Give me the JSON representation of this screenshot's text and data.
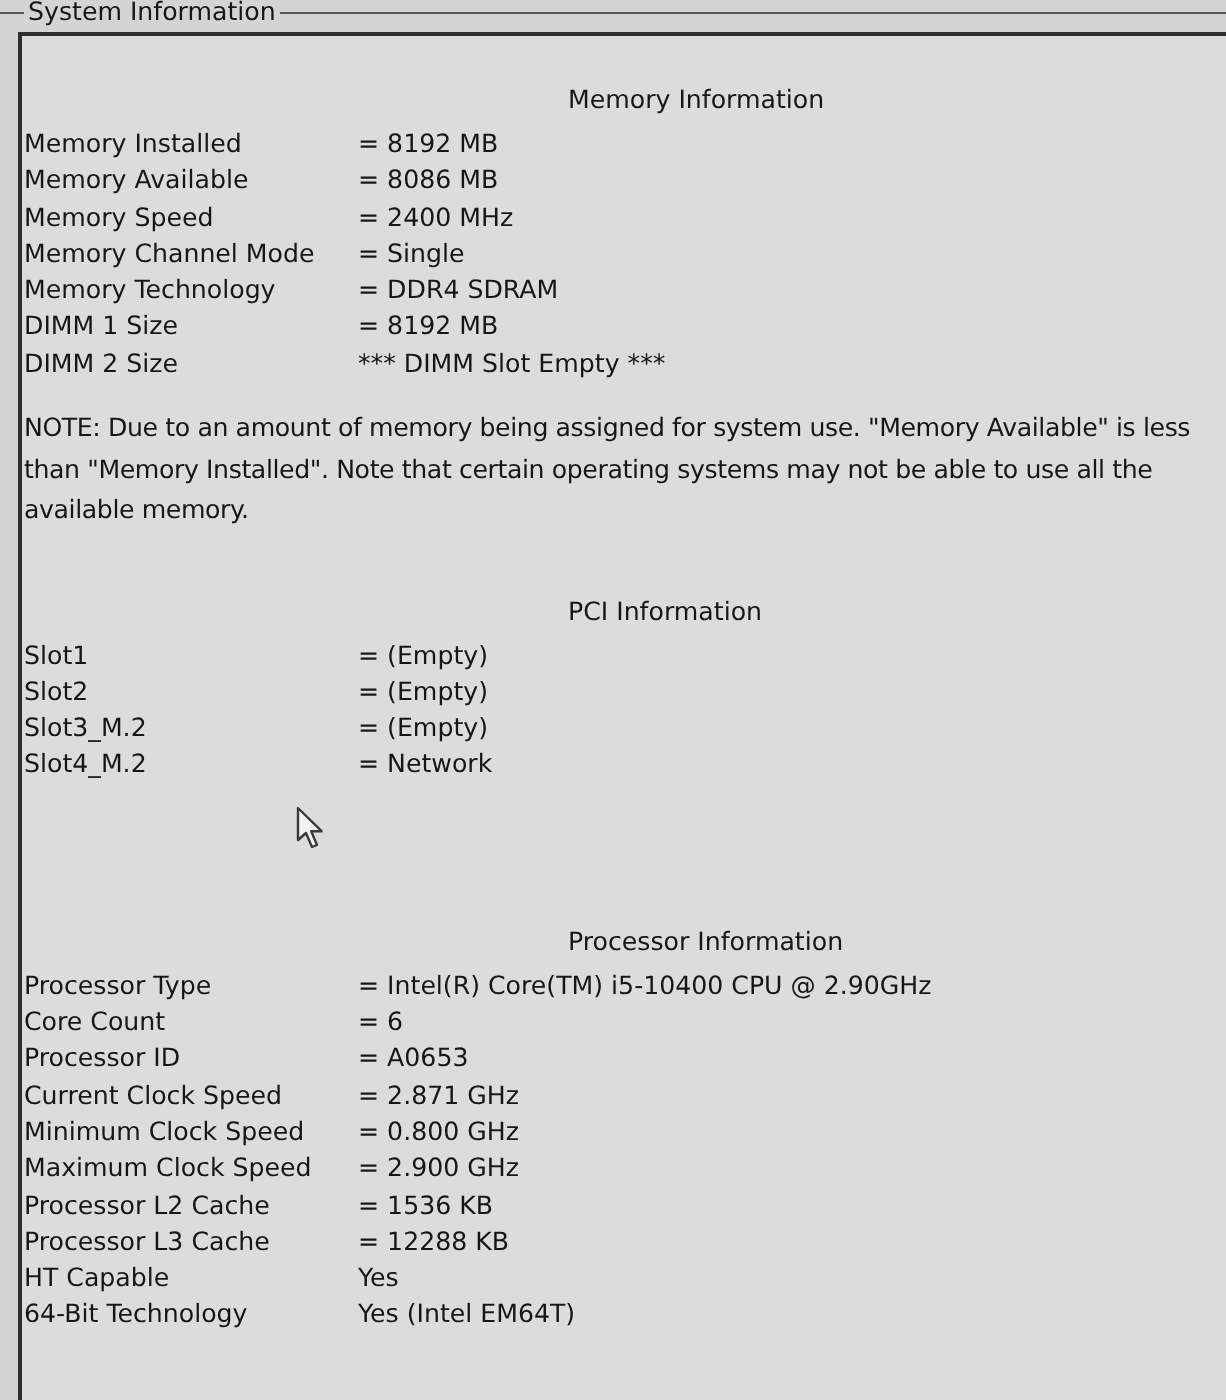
{
  "group_box": {
    "title": "System Information"
  },
  "sections": [
    {
      "heading": "Memory Information",
      "rows": [
        {
          "label": "Memory Installed",
          "value": "= 8192 MB"
        },
        {
          "label": "Memory Available",
          "value": "= 8086 MB"
        },
        {
          "label": "Memory Speed",
          "value": "= 2400 MHz"
        },
        {
          "label": "Memory Channel Mode",
          "value": "= Single"
        },
        {
          "label": "Memory Technology",
          "value": "= DDR4 SDRAM"
        },
        {
          "label": "DIMM 1 Size",
          "value": "= 8192 MB"
        },
        {
          "label": "DIMM 2 Size",
          "value": "*** DIMM Slot Empty ***"
        }
      ],
      "note": "NOTE: Due to an amount of memory being assigned for system use. \"Memory Available\" is less than \"Memory Installed\". Note that certain operating systems may not be able to use all the available memory."
    },
    {
      "heading": "PCI Information",
      "rows": [
        {
          "label": "Slot1",
          "value": "= (Empty)"
        },
        {
          "label": "Slot2",
          "value": "= (Empty)"
        },
        {
          "label": "Slot3_M.2",
          "value": "= (Empty)"
        },
        {
          "label": "Slot4_M.2",
          "value": "= Network"
        }
      ]
    },
    {
      "heading": "Processor Information",
      "rows": [
        {
          "label": "Processor Type",
          "value": "= Intel(R) Core(TM) i5-10400 CPU @ 2.90GHz"
        },
        {
          "label": "Core Count",
          "value": "= 6"
        },
        {
          "label": "Processor ID",
          "value": "= A0653"
        },
        {
          "label": "Current Clock Speed",
          "value": "= 2.871 GHz"
        },
        {
          "label": "Minimum Clock Speed",
          "value": "= 0.800 GHz"
        },
        {
          "label": "Maximum Clock Speed",
          "value": "= 2.900 GHz"
        },
        {
          "label": "Processor L2 Cache",
          "value": "= 1536 KB"
        },
        {
          "label": "Processor L3 Cache",
          "value": "= 12288 KB"
        },
        {
          "label": "HT Capable",
          "value": "Yes"
        },
        {
          "label": "64-Bit Technology",
          "value": "Yes (Intel EM64T)"
        }
      ]
    }
  ]
}
